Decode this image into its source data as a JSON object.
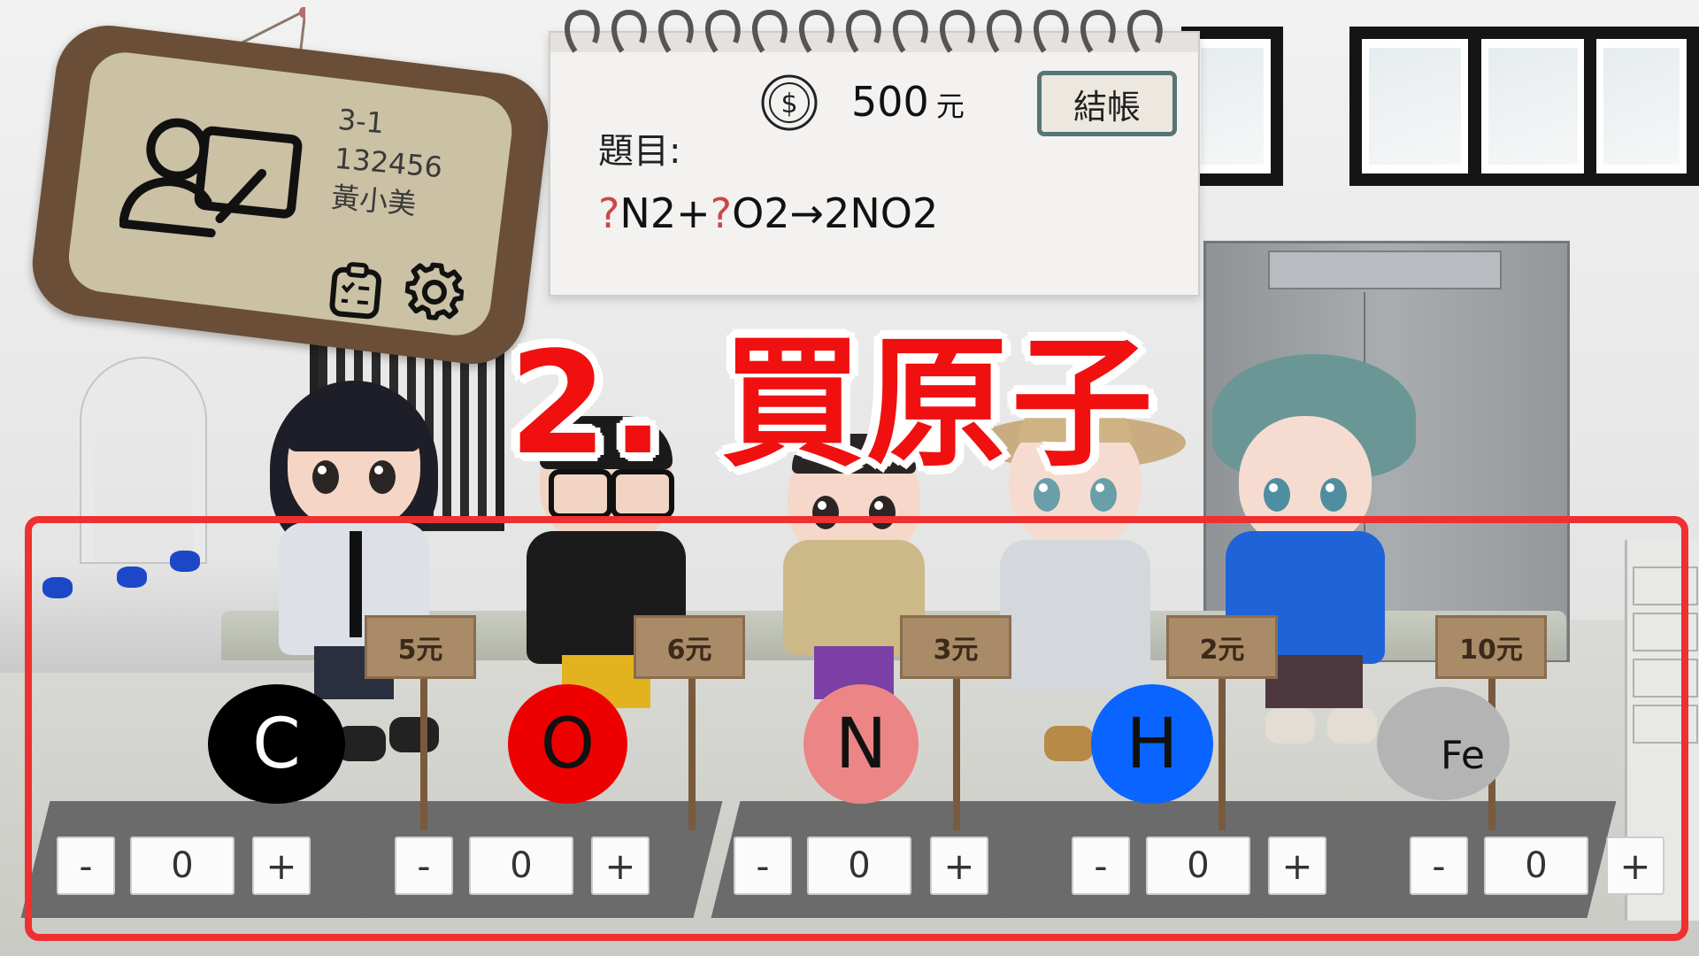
{
  "student": {
    "class": "3-1",
    "id": "132456",
    "name": "黃小美"
  },
  "money": {
    "amount": "500",
    "unit": "元"
  },
  "checkout_label": "結帳",
  "question": {
    "label": "題目:",
    "q1": "?",
    "part1": "N2+",
    "q2": "?",
    "part2": "O2→2NO2"
  },
  "step_title": "2. 買原子",
  "atoms": [
    {
      "symbol": "C",
      "price": "5元",
      "count": "0",
      "color": "#000000",
      "text_color": "#ffffff"
    },
    {
      "symbol": "O",
      "price": "6元",
      "count": "0",
      "color": "#ee0000",
      "text_color": "#111111"
    },
    {
      "symbol": "N",
      "price": "3元",
      "count": "0",
      "color": "#ec8585",
      "text_color": "#111111"
    },
    {
      "symbol": "H",
      "price": "2元",
      "count": "0",
      "color": "#0a64ff",
      "text_color": "#111111"
    },
    {
      "symbol": "Fe",
      "price": "10元",
      "count": "0",
      "color": "#b4b4b4",
      "text_color": "#111111"
    }
  ],
  "controls": {
    "minus": "-",
    "plus": "+"
  },
  "colors": {
    "accent_red": "#f01010",
    "frame_red": "#ef3030",
    "checkout_border": "#567575"
  }
}
